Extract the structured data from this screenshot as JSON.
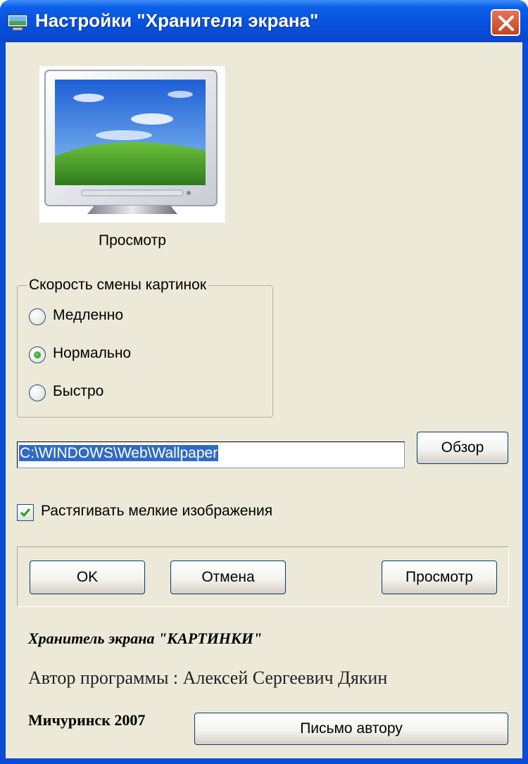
{
  "window": {
    "title": "Настройки \"Хранителя экрана\"",
    "icons": {
      "app": "display-properties-icon",
      "close": "close-icon"
    }
  },
  "preview": {
    "image_description": "monitor-with-bliss-wallpaper",
    "caption": "Просмотр"
  },
  "speed_group": {
    "title": "Скорость смены картинок",
    "options": [
      {
        "label": "Медленно",
        "selected": false
      },
      {
        "label": "Нормально",
        "selected": true
      },
      {
        "label": "Быстро",
        "selected": false
      }
    ]
  },
  "folder": {
    "path": "C:\\WINDOWS\\Web\\Wallpaper",
    "browse_label": "Обзор"
  },
  "stretch": {
    "label": "Растягивать мелкие изображения",
    "checked": true
  },
  "buttons": {
    "ok": "OK",
    "cancel": "Отмена",
    "preview": "Просмотр"
  },
  "footer": {
    "product": "Хранитель экрана \"КАРТИНКИ\"",
    "author": "Автор программы : Алексей Сергеевич Дякин",
    "place_year": "Мичуринск 2007",
    "mail_button": "Письмо автору"
  },
  "colors": {
    "title_bar": "#0650dc",
    "dialog_bg": "#ece9d8",
    "selection": "#316ac5",
    "close_button": "#d5562e"
  }
}
